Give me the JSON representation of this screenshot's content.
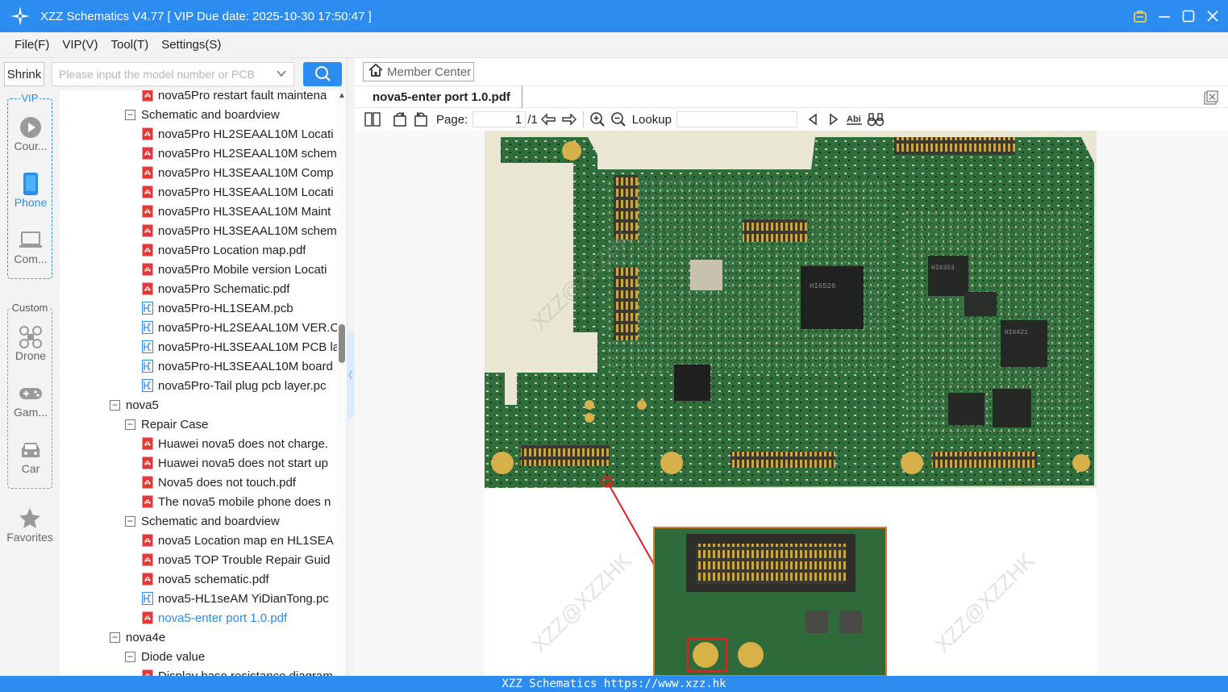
{
  "window": {
    "title": "XZZ Schematics V4.77 [ VIP Due date: 2025-10-30 17:50:47 ]"
  },
  "menu": [
    "File(F)",
    "VIP(V)",
    "Tool(T)",
    "Settings(S)"
  ],
  "search": {
    "shrink_label": "Shrink",
    "placeholder": "Please input the model number or PCB"
  },
  "rail": {
    "vip_title": "VIP",
    "vip_items": [
      "Cour...",
      "Phone",
      "Com..."
    ],
    "custom_title": "Custom",
    "custom_items": [
      "Drone",
      "Gam...",
      "Car"
    ],
    "favorites": "Favorites"
  },
  "tree": [
    {
      "level": 2,
      "type": "pdf",
      "label": "nova5Pro restart fault maintena"
    },
    {
      "level": 1,
      "type": "folder",
      "label": "Schematic and boardview"
    },
    {
      "level": 2,
      "type": "pdf",
      "label": "nova5Pro HL2SEAAL10M Locati"
    },
    {
      "level": 2,
      "type": "pdf",
      "label": "nova5Pro HL2SEAAL10M schem"
    },
    {
      "level": 2,
      "type": "pdf",
      "label": "nova5Pro HL3SEAAL10M Comp"
    },
    {
      "level": 2,
      "type": "pdf",
      "label": "nova5Pro HL3SEAAL10M Locati"
    },
    {
      "level": 2,
      "type": "pdf",
      "label": "nova5Pro HL3SEAAL10M Maint"
    },
    {
      "level": 2,
      "type": "pdf",
      "label": "nova5Pro HL3SEAAL10M schem"
    },
    {
      "level": 2,
      "type": "pdf",
      "label": "nova5Pro Location map.pdf"
    },
    {
      "level": 2,
      "type": "pdf",
      "label": "nova5Pro Mobile version Locati"
    },
    {
      "level": 2,
      "type": "pdf",
      "label": "nova5Pro Schematic.pdf"
    },
    {
      "level": 2,
      "type": "pcb",
      "label": "nova5Pro-HL1SEAM.pcb"
    },
    {
      "level": 2,
      "type": "pcb",
      "label": "nova5Pro-HL2SEAAL10M VER.C"
    },
    {
      "level": 2,
      "type": "pcb",
      "label": "nova5Pro-HL3SEAAL10M PCB la"
    },
    {
      "level": 2,
      "type": "pcb",
      "label": "nova5Pro-HL3SEAAL10M board"
    },
    {
      "level": 2,
      "type": "pcb",
      "label": "nova5Pro-Tail plug pcb layer.pc"
    },
    {
      "level": 0,
      "type": "folder",
      "label": "nova5"
    },
    {
      "level": 1,
      "type": "folder",
      "label": "Repair Case"
    },
    {
      "level": 2,
      "type": "pdf",
      "label": "Huawei nova5 does not charge."
    },
    {
      "level": 2,
      "type": "pdf",
      "label": "Huawei nova5 does not start up"
    },
    {
      "level": 2,
      "type": "pdf",
      "label": "Nova5 does not touch.pdf"
    },
    {
      "level": 2,
      "type": "pdf",
      "label": "The nova5 mobile phone does n"
    },
    {
      "level": 1,
      "type": "folder",
      "label": "Schematic and boardview"
    },
    {
      "level": 2,
      "type": "pdf",
      "label": "nova5 Location map en HL1SEA"
    },
    {
      "level": 2,
      "type": "pdf",
      "label": "nova5 TOP Trouble Repair Guid"
    },
    {
      "level": 2,
      "type": "pdf",
      "label": "nova5 schematic.pdf"
    },
    {
      "level": 2,
      "type": "pcb",
      "label": "nova5-HL1seAM YiDianTong.pc"
    },
    {
      "level": 2,
      "type": "pdf",
      "label": "nova5-enter port 1.0.pdf",
      "selected": true
    },
    {
      "level": 0,
      "type": "folder",
      "label": "nova4e"
    },
    {
      "level": 1,
      "type": "folder",
      "label": "Diode value"
    },
    {
      "level": 2,
      "type": "pdf",
      "label": "Display base resistance diagram"
    }
  ],
  "member_center": "Member Center",
  "doc_tab": "nova5-enter port 1.0.pdf",
  "toolbar": {
    "page_label": "Page:",
    "page_current": "1",
    "page_total": "/1",
    "lookup_label": "Lookup"
  },
  "viewer": {
    "watermark": "XZZ@XZZHK",
    "chip_labels": [
      "HI6526",
      "HI6353",
      "HI6421"
    ]
  },
  "status": "XZZ Schematics https://www.xzz.hk",
  "colors": {
    "accent": "#2d8cf0",
    "pcb_green": "#2f6e3a",
    "highlight_red": "#e02020",
    "zoom_border": "#e07a2e"
  }
}
